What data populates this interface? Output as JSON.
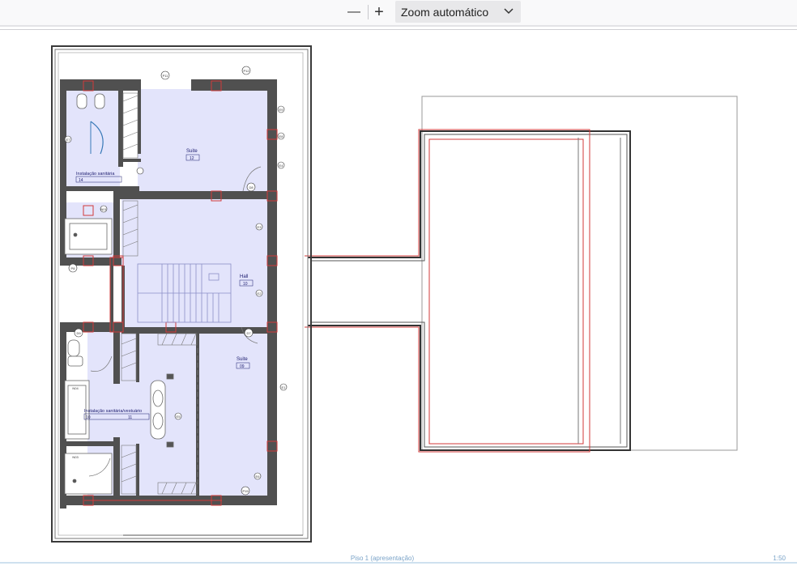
{
  "toolbar": {
    "zoom_out_symbol": "—",
    "zoom_in_symbol": "+",
    "zoom_value": "Zoom automático",
    "zoom_icon": "chevron-down-icon"
  },
  "plan": {
    "rooms": {
      "suite_top": {
        "name": "Suite",
        "code": "12"
      },
      "hall": {
        "name": "Hall",
        "code": "10"
      },
      "suite_bottom": {
        "name": "Suite",
        "code": "09"
      },
      "bath_top": {
        "name": "Instalação sanitária",
        "code": "14"
      },
      "bath_bottom": {
        "name": "Instalação sanitária/vestuário",
        "code": "11",
        "code2": "10"
      }
    },
    "door_tags": [
      "P11",
      "P12",
      "D6",
      "D8",
      "P8",
      "D9",
      "D7",
      "P15"
    ],
    "window_tags": [
      "N04",
      "N03",
      "N01"
    ],
    "small_tags": [
      "E9",
      "E8",
      "E4",
      "E3",
      "E2",
      "E1",
      "E5",
      "E6",
      "E7"
    ]
  },
  "footer": {
    "sheet_title": "Piso 1 (apresentação)",
    "scale": "1:50"
  },
  "colors": {
    "room_fill": "#e3e4fb",
    "wall": "#4a4a4a",
    "outline_red": "#d23a3a",
    "accent_blue": "#3a7ab8",
    "caption": "#7aa3c8"
  }
}
